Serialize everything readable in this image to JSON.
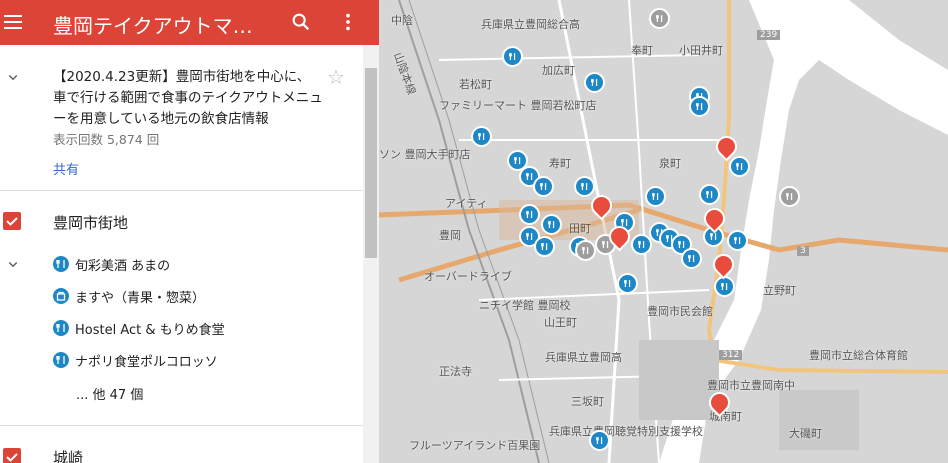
{
  "header": {
    "title": "豊岡テイクアウトマップ"
  },
  "description": {
    "text": "【2020.4.23更新】豊岡市街地を中心に、車で行ける範囲で食事のテイクアウトメニューを用意している地元の飲食店情報",
    "views": "表示回数 5,874 回",
    "share": "共有"
  },
  "layers": [
    {
      "title": "豊岡市街地",
      "items": [
        {
          "label": "旬彩美酒 あまの",
          "icon": "restaurant-icon"
        },
        {
          "label": "ますや（青果・惣菜）",
          "icon": "shop-bag-icon"
        },
        {
          "label": "Hostel Act & もりめ食堂",
          "icon": "restaurant-icon"
        },
        {
          "label": "ナポリ食堂ポルコロッソ",
          "icon": "restaurant-icon"
        }
      ],
      "more": "... 他 47 個"
    },
    {
      "title": "城崎"
    }
  ],
  "map": {
    "labels": {
      "l1": "兵庫県立豊岡総合高",
      "l2": "加広町",
      "l3": "若松町",
      "l4": "ファミリーマート 豊岡若松町店",
      "l5": "ソン 豊岡大手町店",
      "l6": "寿町",
      "l7": "泉町",
      "l8": "アイティ",
      "l9": "豊岡",
      "l10": "オーバードライブ",
      "l11": "ニチイ学館 豊岡校",
      "l12": "山王町",
      "l13": "豊岡市民会館",
      "l14": "兵庫県立豊岡高",
      "l15": "豊岡市立総合体育館",
      "l16": "立野町",
      "l17": "豊岡市立豊岡南中",
      "l18": "三坂町",
      "l19": "城南町",
      "l20": "大磯町",
      "l21": "兵庫県立豊岡聴覚特別支援学校",
      "l22": "フルーツアイランド百果園",
      "l23": "中陰",
      "l24": "奉町",
      "l25": "小田井町",
      "l26": "正法寺",
      "l27": "山陰本線",
      "l28": "田町",
      "r239": "239",
      "r312": "312",
      "r3": "3"
    },
    "colors": {
      "pin_blue": "#1e88c7",
      "pin_red": "#e84c3d",
      "pin_gray": "#9e9e9e",
      "header_red": "#db4437"
    }
  }
}
